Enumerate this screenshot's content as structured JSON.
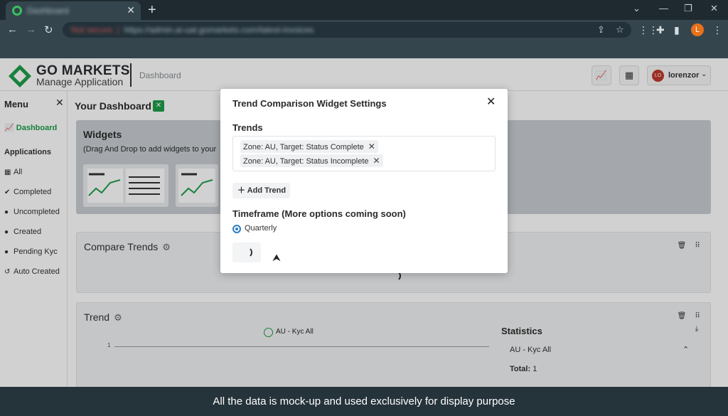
{
  "browser": {
    "tab_title": "Dashboard",
    "address": {
      "not_secure": "Not secure",
      "url": "https://admin.ai-uat.gomarkets.com/latest-invoices"
    },
    "profile_initial": "L"
  },
  "header": {
    "brand": "GO MARKETS",
    "brand_sub": "Manage Application",
    "breadcrumb": "Dashboard",
    "user": {
      "initials": "LO",
      "name": "lorenzor"
    }
  },
  "sidebar": {
    "title": "Menu",
    "active_item": "Dashboard",
    "section": "Applications",
    "items": [
      {
        "label": "All",
        "icon": "table-icon"
      },
      {
        "label": "Completed",
        "icon": "check-icon"
      },
      {
        "label": "Uncompleted",
        "icon": "alert-icon"
      },
      {
        "label": "Created",
        "icon": "check-circle-icon"
      },
      {
        "label": "Pending Kyc",
        "icon": "question-icon"
      },
      {
        "label": "Auto Created",
        "icon": "history-icon"
      }
    ]
  },
  "main": {
    "title": "Your Dashboard",
    "widgets_title": "Widgets",
    "widgets_subtitle": "(Drag And Drop to add widgets to your",
    "compare_card_title": "Compare Trends",
    "trend_card_title": "Trend",
    "legend_label": "AU - Kyc All",
    "axis_tick": "1",
    "statistics": {
      "title": "Statistics",
      "row_label": "AU - Kyc All",
      "total_label": "Total:",
      "total_value": "1"
    }
  },
  "modal": {
    "title": "Trend Comparison Widget Settings",
    "trends_label": "Trends",
    "chips": [
      "Zone: AU, Target: Status Complete",
      "Zone: AU, Target: Status Incomplete"
    ],
    "add_trend_label": "Add Trend",
    "timeframe_label": "Timeframe (More options coming soon)",
    "timeframe_option": "Quarterly"
  },
  "caption": "All the data is mock-up and used exclusively for display purpose",
  "colors": {
    "brand_green": "#1e9e4a",
    "radio_blue": "#2f7fc1",
    "chrome_dark": "#34454e"
  }
}
